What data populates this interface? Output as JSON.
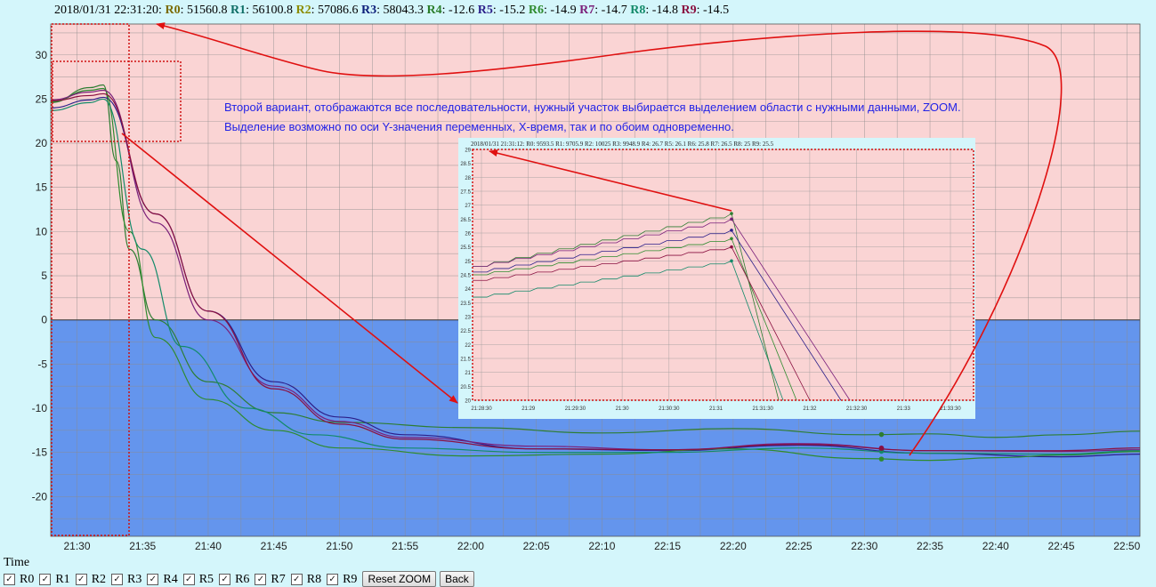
{
  "header": {
    "timestamp": "2018/01/31 22:31:20:",
    "readings": [
      {
        "name": "R0",
        "value": "51560.8",
        "color": "#7a6a00"
      },
      {
        "name": "R1",
        "value": "56100.8",
        "color": "#0e6e66"
      },
      {
        "name": "R2",
        "value": "57086.6",
        "color": "#8c8c00"
      },
      {
        "name": "R3",
        "value": "58043.3",
        "color": "#0e1f7a"
      },
      {
        "name": "R4",
        "value": "-12.6",
        "color": "#2a7d2a"
      },
      {
        "name": "R5",
        "value": "-15.2",
        "color": "#2c1f8a"
      },
      {
        "name": "R6",
        "value": "-14.9",
        "color": "#2e8b2e"
      },
      {
        "name": "R7",
        "value": "-14.7",
        "color": "#7a1f7a"
      },
      {
        "name": "R8",
        "value": "-14.8",
        "color": "#138a6a"
      },
      {
        "name": "R9",
        "value": "-14.5",
        "color": "#8a1040"
      }
    ]
  },
  "annotation": {
    "line1": "Второй вариант, отображаются все последовательности, нужный участок выбирается выделением области с нужными данными, ZOOM.",
    "line2": "Выделение возможно по оси Y-значения переменных, X-время, так и по обоим одновременно."
  },
  "inset": {
    "header_text": "2018/01/31 21:31:12: R0: 9593.5 R1: 9705.9 R2: 10025 R3: 9948.9 R4: 26.7 R5: 26.1 R6: 25.8 R7: 26.5 R8: 25 R9: 25.5",
    "yticks": [
      "29",
      "28.5",
      "28",
      "27.5",
      "27",
      "26.5",
      "26",
      "25.5",
      "25",
      "24.5",
      "24",
      "23.5",
      "23",
      "22.5",
      "22",
      "21.5",
      "21",
      "20.5",
      "20"
    ],
    "xticks": [
      "21:28:30",
      "21:29",
      "21:29:30",
      "21:30",
      "21:30:30",
      "21:31",
      "21:31:30",
      "21:32",
      "21:32:30",
      "21:33",
      "21:33:30"
    ]
  },
  "chart_data": {
    "type": "line",
    "title": "",
    "xlabel": "Time",
    "ylabel": "",
    "ylim": [
      -24.5,
      33.5
    ],
    "xlim_minutes": [
      1288,
      1371
    ],
    "y_ticks": [
      30,
      25,
      20,
      15,
      10,
      5,
      0,
      -5,
      -10,
      -15,
      -20
    ],
    "x_tick_labels": [
      "21:30",
      "21:35",
      "21:40",
      "21:45",
      "21:50",
      "21:55",
      "22:00",
      "22:05",
      "22:10",
      "22:15",
      "22:20",
      "22:25",
      "22:30",
      "22:35",
      "22:40",
      "22:45",
      "22:50"
    ],
    "positive_region_color": "#fad4d4",
    "negative_region_color": "#6495ed",
    "series": [
      {
        "name": "R4",
        "color": "#2e7d32",
        "points": [
          [
            1288,
            24.6
          ],
          [
            1291,
            26.3
          ],
          [
            1292,
            26.6
          ],
          [
            1293,
            18
          ],
          [
            1294,
            8
          ],
          [
            1296,
            0
          ],
          [
            1300,
            -7
          ],
          [
            1305,
            -10.5
          ],
          [
            1310,
            -11.6
          ],
          [
            1320,
            -12.2
          ],
          [
            1330,
            -12.8
          ],
          [
            1340,
            -12.3
          ],
          [
            1350,
            -13.0
          ],
          [
            1355,
            -12.9
          ],
          [
            1360,
            -13.3
          ],
          [
            1365,
            -13.0
          ],
          [
            1371,
            -12.6
          ]
        ]
      },
      {
        "name": "R5",
        "color": "#2c1f8a",
        "points": [
          [
            1288,
            24.0
          ],
          [
            1291,
            24.9
          ],
          [
            1292,
            25.2
          ],
          [
            1296,
            12
          ],
          [
            1300,
            1
          ],
          [
            1305,
            -7
          ],
          [
            1310,
            -11
          ],
          [
            1315,
            -13
          ],
          [
            1325,
            -14.6
          ],
          [
            1335,
            -14.8
          ],
          [
            1345,
            -14.2
          ],
          [
            1355,
            -15.1
          ],
          [
            1365,
            -15.5
          ],
          [
            1371,
            -15.2
          ]
        ]
      },
      {
        "name": "R6",
        "color": "#2e8b2e",
        "points": [
          [
            1288,
            24.7
          ],
          [
            1291,
            26.0
          ],
          [
            1292,
            26.2
          ],
          [
            1294,
            10
          ],
          [
            1296,
            -2
          ],
          [
            1300,
            -9
          ],
          [
            1305,
            -12.5
          ],
          [
            1310,
            -14.5
          ],
          [
            1320,
            -15.4
          ],
          [
            1330,
            -15.2
          ],
          [
            1340,
            -14.6
          ],
          [
            1350,
            -15.7
          ],
          [
            1355,
            -15.9
          ],
          [
            1360,
            -15.6
          ],
          [
            1365,
            -15.3
          ],
          [
            1371,
            -14.9
          ]
        ]
      },
      {
        "name": "R7",
        "color": "#7a1f7a",
        "points": [
          [
            1288,
            24.9
          ],
          [
            1291,
            25.8
          ],
          [
            1292,
            26.0
          ],
          [
            1296,
            11
          ],
          [
            1300,
            0
          ],
          [
            1305,
            -7.5
          ],
          [
            1310,
            -11.5
          ],
          [
            1315,
            -13.3
          ],
          [
            1325,
            -14.3
          ],
          [
            1335,
            -14.7
          ],
          [
            1345,
            -14.0
          ],
          [
            1355,
            -14.8
          ],
          [
            1365,
            -14.9
          ],
          [
            1371,
            -14.7
          ]
        ]
      },
      {
        "name": "R8",
        "color": "#138a6a",
        "points": [
          [
            1288,
            23.7
          ],
          [
            1291,
            24.6
          ],
          [
            1292,
            25.0
          ],
          [
            1295,
            8
          ],
          [
            1298,
            -3
          ],
          [
            1303,
            -10
          ],
          [
            1308,
            -13
          ],
          [
            1315,
            -14.5
          ],
          [
            1325,
            -15.0
          ],
          [
            1335,
            -15.0
          ],
          [
            1345,
            -14.5
          ],
          [
            1355,
            -15.1
          ],
          [
            1365,
            -15.2
          ],
          [
            1371,
            -14.8
          ]
        ]
      },
      {
        "name": "R9",
        "color": "#8a1040",
        "points": [
          [
            1288,
            24.8
          ],
          [
            1291,
            25.4
          ],
          [
            1292,
            25.6
          ],
          [
            1296,
            12
          ],
          [
            1300,
            1
          ],
          [
            1305,
            -7.8
          ],
          [
            1310,
            -11.8
          ],
          [
            1315,
            -13.5
          ],
          [
            1325,
            -14.6
          ],
          [
            1335,
            -14.7
          ],
          [
            1345,
            -14.1
          ],
          [
            1355,
            -14.8
          ],
          [
            1365,
            -14.8
          ],
          [
            1371,
            -14.5
          ]
        ]
      }
    ]
  },
  "footer": {
    "time_label": "Time",
    "checkboxes": [
      {
        "label": "R0",
        "checked": true
      },
      {
        "label": "R1",
        "checked": true
      },
      {
        "label": "R2",
        "checked": true
      },
      {
        "label": "R3",
        "checked": true
      },
      {
        "label": "R4",
        "checked": true
      },
      {
        "label": "R5",
        "checked": true
      },
      {
        "label": "R6",
        "checked": true
      },
      {
        "label": "R7",
        "checked": true
      },
      {
        "label": "R8",
        "checked": true
      },
      {
        "label": "R9",
        "checked": true
      }
    ],
    "reset_zoom_label": "Reset ZOOM",
    "back_label": "Back"
  }
}
